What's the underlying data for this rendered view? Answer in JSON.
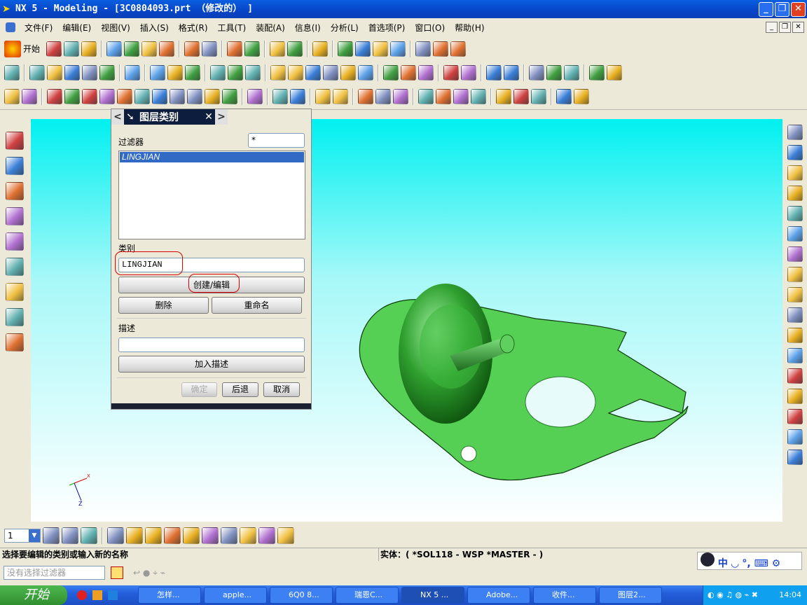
{
  "window": {
    "title": "NX 5 - Modeling - [3C0804093.prt （修改的） ]",
    "buttons": [
      "_",
      "❐",
      "✕"
    ]
  },
  "menu": [
    "文件(F)",
    "编辑(E)",
    "视图(V)",
    "插入(S)",
    "格式(R)",
    "工具(T)",
    "装配(A)",
    "信息(I)",
    "分析(L)",
    "首选项(P)",
    "窗口(O)",
    "帮助(H)"
  ],
  "mdi_buttons": [
    "_",
    "❐",
    "✕"
  ],
  "toolbar": {
    "start_label": "开始",
    "row1": [
      "new-file-icon",
      "open-folder-icon",
      "save-icon",
      "|",
      "cut-icon",
      "copy-icon",
      "paste-icon",
      "delete-icon",
      "|",
      "undo-icon",
      "redo-icon",
      "|",
      "edit-object-icon",
      "select-icon",
      "|",
      "measure-distance-icon",
      "measure-angle-icon",
      "|",
      "analysis-icon",
      "|",
      "deviation-icon",
      "curve-analysis-icon",
      "curvature-icon",
      "draft-analysis-icon",
      "|",
      "wave-link-icon",
      "section-icon",
      "surface-analysis-icon"
    ],
    "row2": [
      "assembly-nav-icon",
      "|",
      "view-front-icon",
      "view-iso-icon",
      "view-shaded-icon",
      "view-wire-icon",
      "view-cylinder-icon",
      "|",
      "view-cube-icon",
      "|",
      "extrude-icon",
      "sweep-icon",
      "revolve-icon",
      "|",
      "cylinder-icon",
      "cone-icon",
      "sphere-icon",
      "|",
      "surface-ruled-icon",
      "surface-mesh-icon",
      "surface-through-icon",
      "surface-sweep-icon",
      "surface-bridge-icon",
      "surface-nsided-icon",
      "|",
      "offset-surface-icon",
      "thicken-icon",
      "sew-icon",
      "|",
      "trim-body-icon",
      "split-body-icon",
      "|",
      "bounded-plane-icon",
      "fill-surface-icon",
      "|",
      "extension-icon",
      "law-extension-icon",
      "quilt-icon",
      "|",
      "transition-icon",
      "flange-icon"
    ],
    "row3": [
      "datum-point-icon",
      "rectangle-icon",
      "|",
      "extrude-feature-icon",
      "block-icon",
      "pad-icon",
      "boss-icon",
      "pocket-icon",
      "slot-icon",
      "groove-icon",
      "tube-icon",
      "rib-icon",
      "hole-icon",
      "thread-icon",
      "|",
      "feature-pattern-icon",
      "|",
      "blend-icon",
      "chamfer-icon",
      "|",
      "datum-plane-icon",
      "datum-csys-icon",
      "|",
      "edge-blend-icon",
      "face-blend-icon",
      "shell-icon",
      "|",
      "draft-icon",
      "taper-icon",
      "offset-face-icon",
      "replace-face-icon",
      "|",
      "trim-icon",
      "unite-icon",
      "subtract-icon",
      "|",
      "intersect-icon",
      "move-face-icon"
    ]
  },
  "left_toolbar": [
    "assembly-navigator-icon",
    "part-navigator-icon",
    "web-browser-icon",
    "history-icon",
    "system-materials-icon",
    "palette-icon",
    "roles-icon",
    "users-icon",
    "image-icon"
  ],
  "right_toolbar": [
    "link-icon",
    "line-icon",
    "axis-line-icon",
    "parallel-line-icon",
    "perpendicular-line-icon",
    "tangent-line-icon",
    "circle-tangent-icon",
    "grid-icon",
    "arc-icon",
    "arc-three-point-icon",
    "fillet-icon",
    "corner-icon",
    "circle-icon",
    "circle-center-icon",
    "circle-tangent-icon",
    "circle-point-icon",
    "circle-center-point-icon"
  ],
  "dialog": {
    "title": "图层类别",
    "filter_label": "过滤器",
    "filter_value": "*",
    "list_items": [
      "LINGJIAN"
    ],
    "category_label": "类别",
    "category_value": "LINGJIAN",
    "create_edit": "创建/编辑",
    "delete": "删除",
    "rename": "重命名",
    "description_label": "描述",
    "description_value": "",
    "add_description": "加入描述",
    "ok": "确定",
    "back": "后退",
    "cancel": "取消"
  },
  "triad": {
    "x": "X",
    "y": "Y",
    "z": "Z"
  },
  "bottom_toolbar": {
    "layer_value": "1",
    "icons": [
      "layer-settings-icon",
      "layer-visible-icon",
      "layer-move-icon",
      "|",
      "wcs-origin-icon",
      "wcs-dynamic-icon",
      "wcs-rotate-icon",
      "wcs-origin-point-icon",
      "wcs-save-icon",
      "wcs-display-icon",
      "snap-icon",
      "snap-point-icon",
      "snap-end-icon",
      "snap-mid-icon"
    ]
  },
  "status": {
    "prompt": "选择要编辑的类别或输入新的名称",
    "selection": "实体：( *SOL118 - WSP *MASTER - )"
  },
  "filter_bar": {
    "placeholder": "没有选择过滤器"
  },
  "ime": {
    "label": "中 ◡ °,"
  },
  "taskbar": {
    "start": "开始",
    "tasks": [
      "怎样...",
      "apple...",
      "6Q0 8...",
      "瑞恩C...",
      "NX 5 ...",
      "Adobe...",
      "收件...",
      "图层2..."
    ],
    "active_index": 4,
    "clock": "14:04"
  },
  "colors": {
    "part_green": "#55d055",
    "viewport_top": "#00f0f0",
    "titlebar": "#0a5fe0",
    "list_selection": "#316ac5",
    "highlight_red": "#dd0000"
  }
}
